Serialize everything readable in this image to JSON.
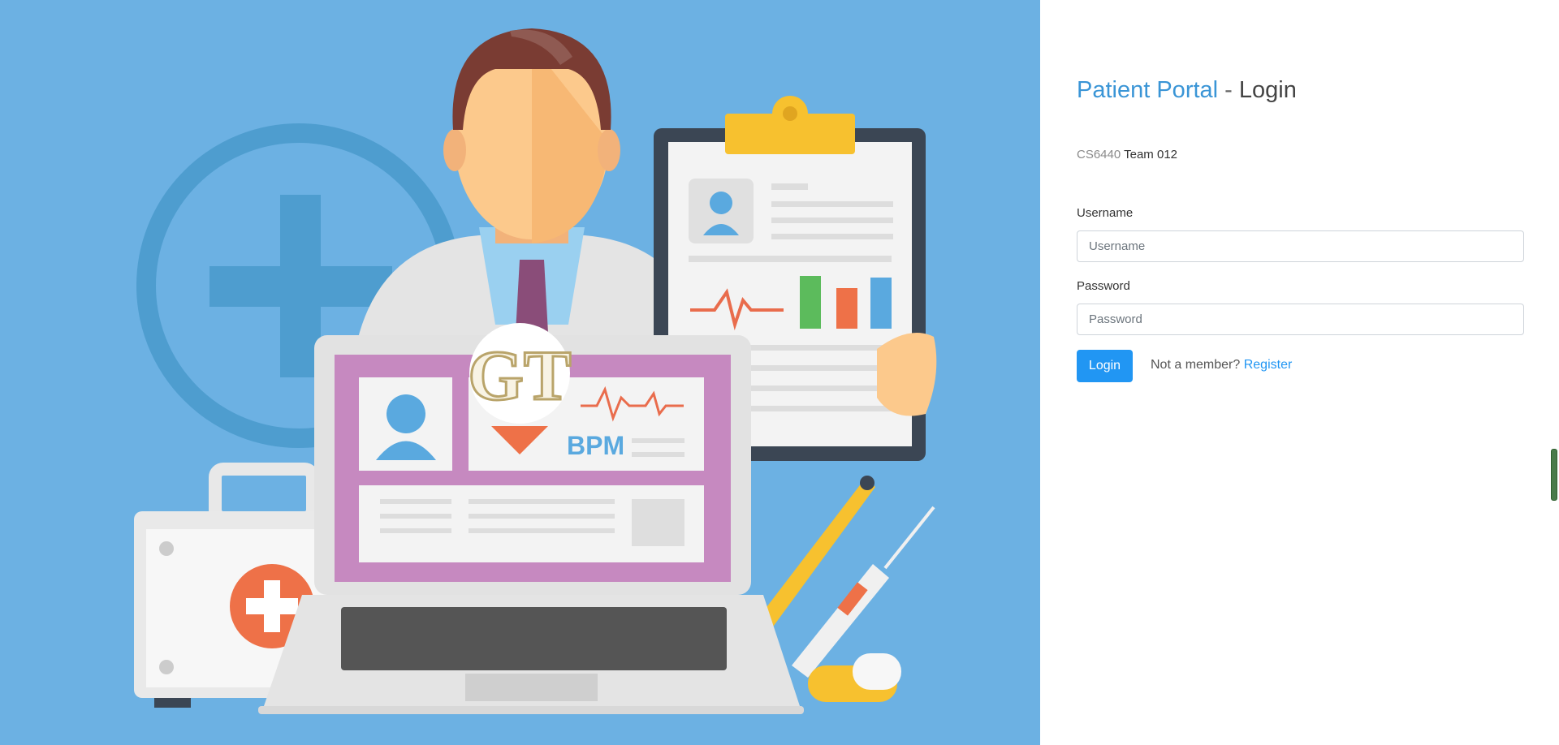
{
  "hero": {
    "logo_text": "GT",
    "bpm_label": "BPM"
  },
  "login": {
    "title_brand": "Patient Portal",
    "title_separator": "-",
    "title_page": "Login",
    "course": "CS6440",
    "team": "Team 012",
    "username_label": "Username",
    "username_placeholder": "Username",
    "username_value": "",
    "password_label": "Password",
    "password_placeholder": "Password",
    "password_value": "",
    "login_button": "Login",
    "not_member_text": "Not a member?",
    "register_link": "Register"
  },
  "colors": {
    "hero_background": "#6cb1e3",
    "brand_blue": "#3a95d6",
    "button_blue": "#2196f3"
  }
}
